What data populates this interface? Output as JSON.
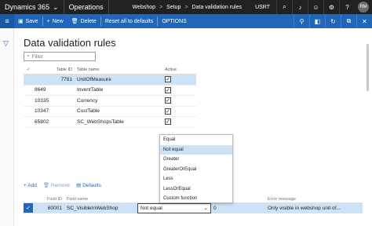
{
  "topbar": {
    "app_name": "Dynamics 365",
    "module": "Operations",
    "breadcrumb": [
      "Webshop",
      "Setup",
      "Data validation rules"
    ],
    "company": "USRT",
    "icons": [
      "search-icon",
      "bell-icon",
      "smiley-icon",
      "gear-icon",
      "help-icon"
    ],
    "avatar": "RM"
  },
  "actionbar": {
    "save": "Save",
    "new": "New",
    "delete": "Delete",
    "reset": "Reset all to defaults",
    "options": "OPTIONS"
  },
  "page": {
    "title": "Data validation rules",
    "filter_placeholder": "Filter"
  },
  "tables_grid": {
    "headers": {
      "table_id": "Table ID",
      "table_name": "Table name",
      "active": "Active"
    },
    "rows": [
      {
        "table_id": "7781",
        "table_name": "UnitOfMeasure",
        "active": true
      },
      {
        "table_id": "8649",
        "table_name": "InventTable",
        "active": true
      },
      {
        "table_id": "10335",
        "table_name": "Currency",
        "active": true
      },
      {
        "table_id": "10347",
        "table_name": "CustTable",
        "active": true
      },
      {
        "table_id": "65802",
        "table_name": "SC_WebShopsTable",
        "active": true
      }
    ]
  },
  "dropdown": {
    "options": [
      "Equal",
      "Not equal",
      "Greater",
      "GreaterOrEqual",
      "Less",
      "LessOrEqual",
      "Custom function"
    ],
    "highlighted": "Not equal"
  },
  "fields_toolbar": {
    "add": "Add",
    "remove": "Remove",
    "defaults": "Defaults"
  },
  "fields_grid": {
    "headers": {
      "field_id": "Field ID",
      "field_name": "Field name",
      "operator": "",
      "value": "Value",
      "error_message": "Error message"
    },
    "row": {
      "field_id": "60001",
      "field_name": "SC_VisibleInWebShop",
      "operator": "Not equal",
      "value": "0",
      "error_message": "Only visible in webshop unit of..."
    }
  },
  "colors": {
    "topbar": "#212121",
    "actionbar": "#2266b7",
    "selection": "#cde3f5"
  }
}
